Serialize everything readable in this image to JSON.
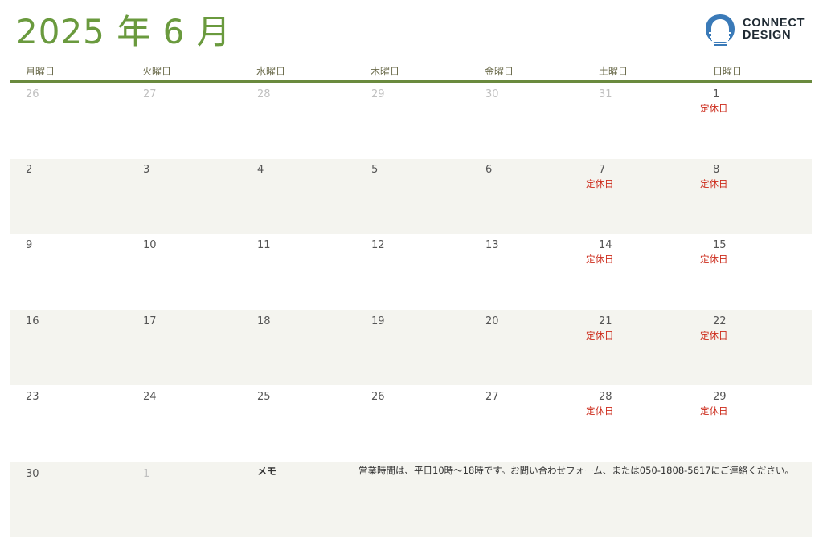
{
  "title": "2025 年 6 月",
  "logo": {
    "line1": "CONNECT",
    "line2": "DESIGN"
  },
  "weekdays": [
    "月曜日",
    "火曜日",
    "水曜日",
    "木曜日",
    "金曜日",
    "土曜日",
    "日曜日"
  ],
  "holiday_label": "定休日",
  "weeks": [
    [
      "26",
      "27",
      "28",
      "29",
      "30",
      "31",
      "1"
    ],
    [
      "2",
      "3",
      "4",
      "5",
      "6",
      "7",
      "8"
    ],
    [
      "9",
      "10",
      "11",
      "12",
      "13",
      "14",
      "15"
    ],
    [
      "16",
      "17",
      "18",
      "19",
      "20",
      "21",
      "22"
    ],
    [
      "23",
      "24",
      "25",
      "26",
      "27",
      "28",
      "29"
    ],
    [
      "30",
      "1"
    ]
  ],
  "memo": {
    "label": "メモ",
    "text": "営業時間は、平日10時～18時です。お問い合わせフォーム、または050-1808-5617にご連絡ください。"
  },
  "colors": {
    "accent": "#6a9a3e",
    "holiday": "#cc2a1a",
    "logo": "#3a7ab8"
  }
}
